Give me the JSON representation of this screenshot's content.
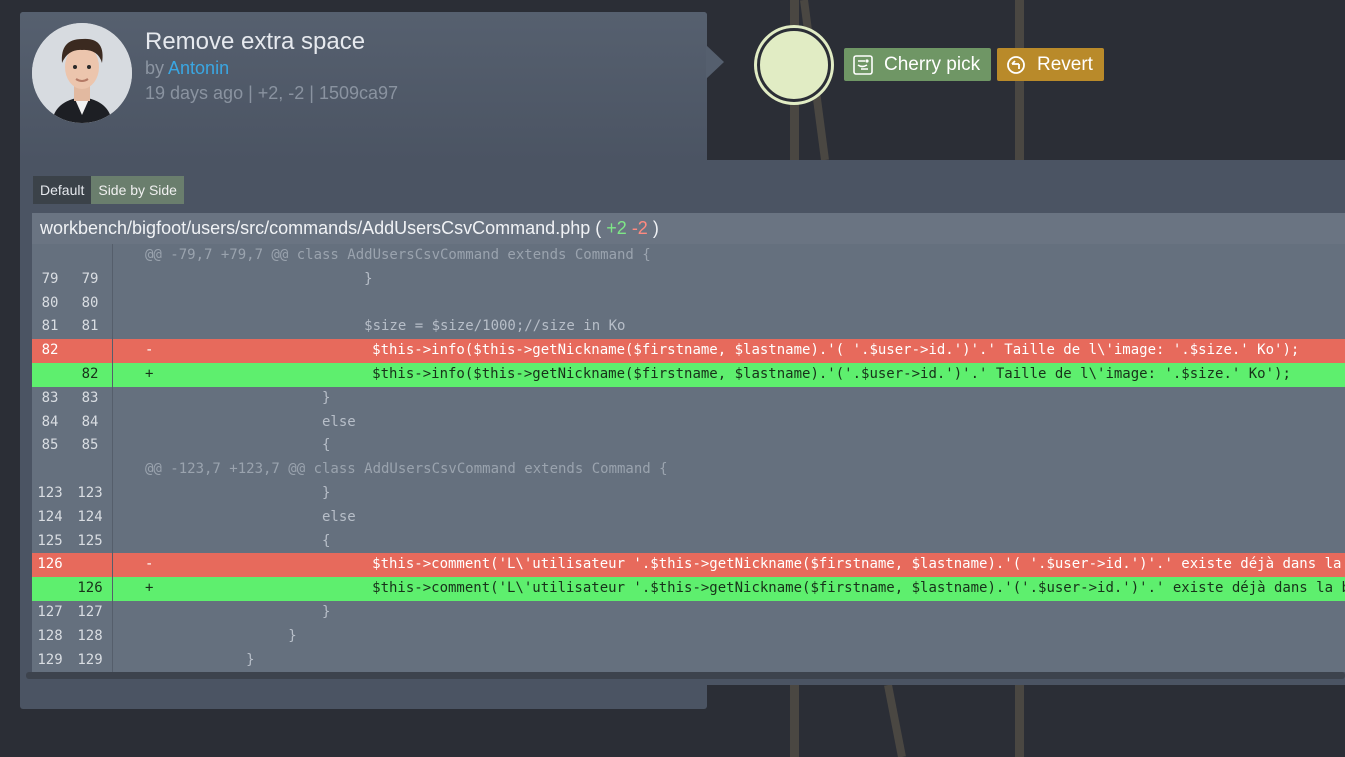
{
  "commit": {
    "title": "Remove extra space",
    "by_prefix": "by",
    "author": "Antonin",
    "meta": "19 days ago | +2, -2 | 1509ca97"
  },
  "actions": {
    "cherry_pick": "Cherry pick",
    "revert": "Revert"
  },
  "view_tabs": [
    "Default",
    "Side by Side"
  ],
  "file": {
    "path": "workbench/bigfoot/users/src/commands/AddUsersCsvCommand.php",
    "open": "(",
    "additions": "+2",
    "deletions": "-2",
    "close": ")"
  },
  "diff_rows": [
    {
      "type": "hunk",
      "old": "",
      "new": "",
      "sign": "",
      "code": "@@ -79,7 +79,7 @@ class AddUsersCsvCommand extends Command {"
    },
    {
      "type": "ctx",
      "old": "79",
      "new": "79",
      "sign": "",
      "code": "                          }"
    },
    {
      "type": "ctx",
      "old": "80",
      "new": "80",
      "sign": "",
      "code": ""
    },
    {
      "type": "ctx",
      "old": "81",
      "new": "81",
      "sign": "",
      "code": "                          $size = $size/1000;//size in Ko"
    },
    {
      "type": "del",
      "old": "82",
      "new": "",
      "sign": "-",
      "code": "                          $this->info($this->getNickname($firstname, $lastname).'( '.$user->id.')'.' Taille de l\\'image: '.$size.' Ko');"
    },
    {
      "type": "add",
      "old": "",
      "new": "82",
      "sign": "+",
      "code": "                          $this->info($this->getNickname($firstname, $lastname).'('.$user->id.')'.' Taille de l\\'image: '.$size.' Ko');"
    },
    {
      "type": "ctx",
      "old": "83",
      "new": "83",
      "sign": "",
      "code": "                     }"
    },
    {
      "type": "ctx",
      "old": "84",
      "new": "84",
      "sign": "",
      "code": "                     else"
    },
    {
      "type": "ctx",
      "old": "85",
      "new": "85",
      "sign": "",
      "code": "                     {"
    },
    {
      "type": "hunk",
      "old": "",
      "new": "",
      "sign": "",
      "code": "@@ -123,7 +123,7 @@ class AddUsersCsvCommand extends Command {"
    },
    {
      "type": "ctx",
      "old": "123",
      "new": "123",
      "sign": "",
      "code": "                     }"
    },
    {
      "type": "ctx",
      "old": "124",
      "new": "124",
      "sign": "",
      "code": "                     else"
    },
    {
      "type": "ctx",
      "old": "125",
      "new": "125",
      "sign": "",
      "code": "                     {"
    },
    {
      "type": "del",
      "old": "126",
      "new": "",
      "sign": "-",
      "code": "                          $this->comment('L\\'utilisateur '.$this->getNickname($firstname, $lastname).'( '.$user->id.')'.' existe déjà dans la base de données');"
    },
    {
      "type": "add",
      "old": "",
      "new": "126",
      "sign": "+",
      "code": "                          $this->comment('L\\'utilisateur '.$this->getNickname($firstname, $lastname).'('.$user->id.')'.' existe déjà dans la base de données');"
    },
    {
      "type": "ctx",
      "old": "127",
      "new": "127",
      "sign": "",
      "code": "                     }"
    },
    {
      "type": "ctx",
      "old": "128",
      "new": "128",
      "sign": "",
      "code": "                 }"
    },
    {
      "type": "ctx",
      "old": "129",
      "new": "129",
      "sign": "",
      "code": "            }"
    }
  ],
  "colors": {
    "background": "#2b2e36",
    "card": "#4b5463",
    "deleted_line": "#e76a5c",
    "added_line": "#5eef6e",
    "cherry_pick": "#6f9665",
    "revert": "#b98a2a",
    "author_link": "#3aa7e3",
    "commit_node": "#e1ecc4"
  },
  "icons": {
    "cherry_pick": "cherry-pick-icon",
    "revert": "revert-icon"
  }
}
